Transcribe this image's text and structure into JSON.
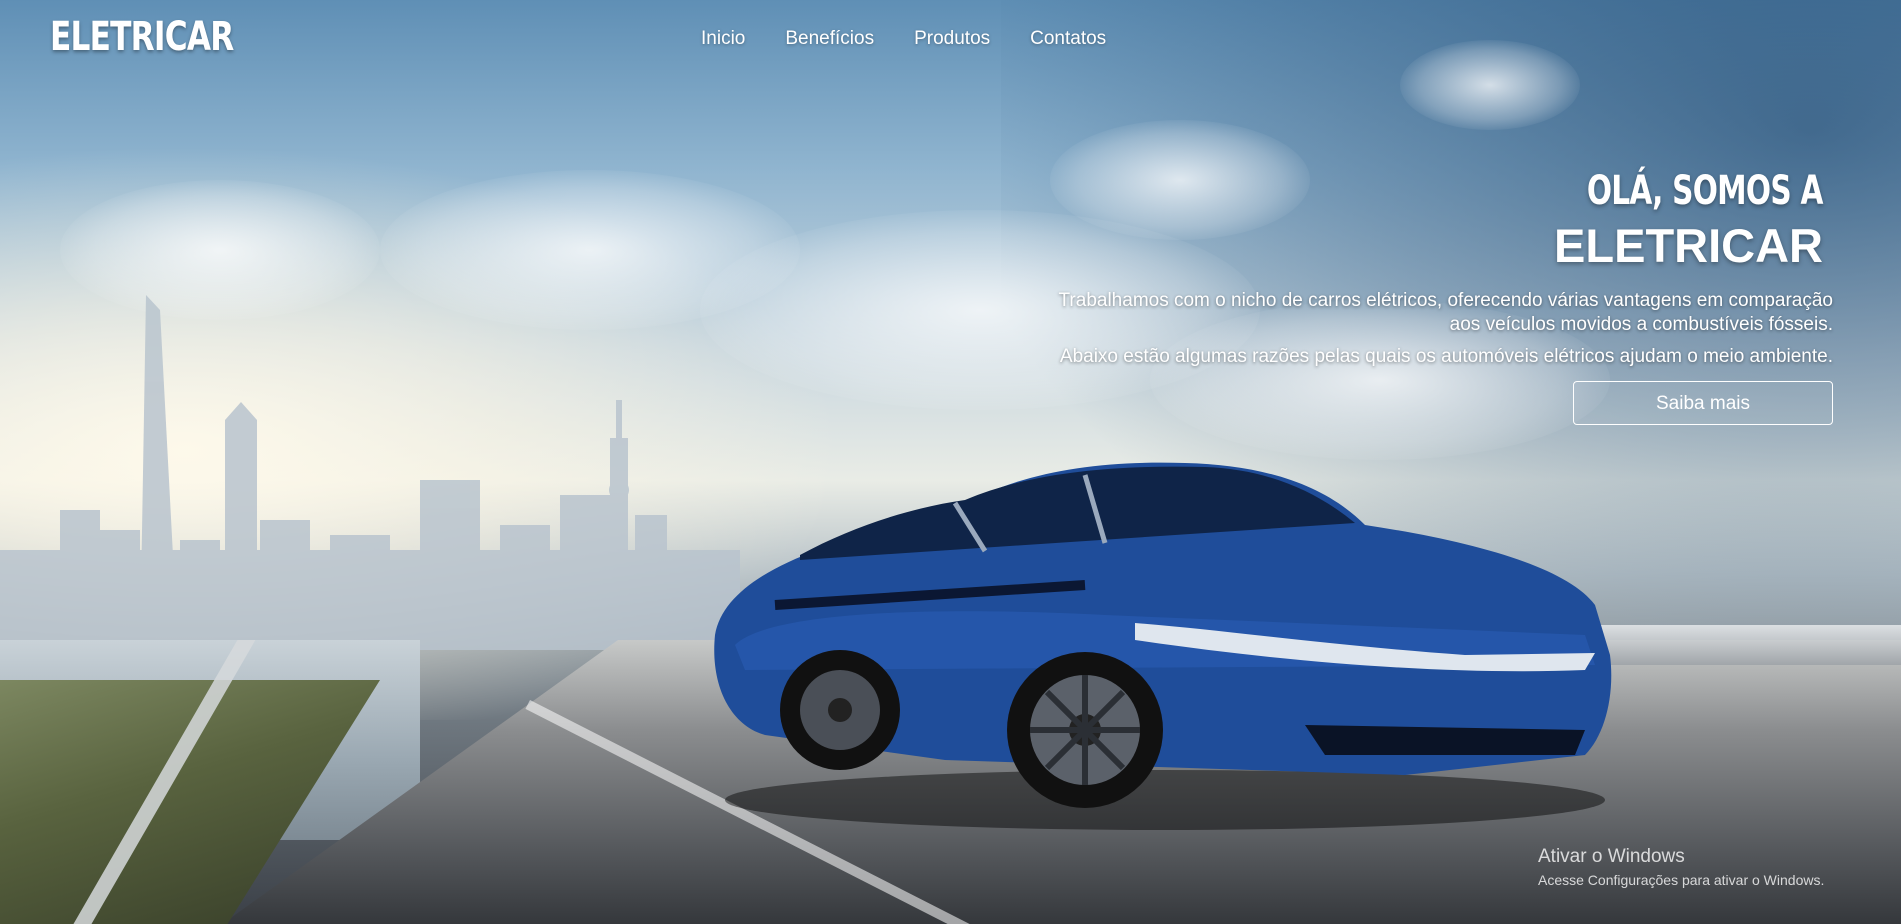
{
  "header": {
    "logo": "ELETRICAR",
    "nav": [
      {
        "label": "Inicio"
      },
      {
        "label": "Benefícios"
      },
      {
        "label": "Produtos"
      },
      {
        "label": "Contatos"
      }
    ]
  },
  "hero": {
    "greeting": "OLÁ, SOMOS A",
    "brand": "ELETRICAR",
    "description_line1": "Trabalhamos com o nicho de carros elétricos, oferecendo várias vantagens em comparação",
    "description_line2": "aos veículos movidos a combustíveis fósseis.",
    "description_2": "Abaixo estão algumas razões pelas quais os automóveis elétricos ajudam o meio ambiente.",
    "cta_label": "Saiba mais",
    "image": "blue-electric-sedan-on-highway-city-skyline"
  },
  "watermark": {
    "title": "Ativar o Windows",
    "subtitle": "Acesse Configurações para ativar o Windows."
  },
  "colors": {
    "text": "#ffffff",
    "car_body": "#1f4d9a",
    "sky": "#6f9ac0"
  }
}
